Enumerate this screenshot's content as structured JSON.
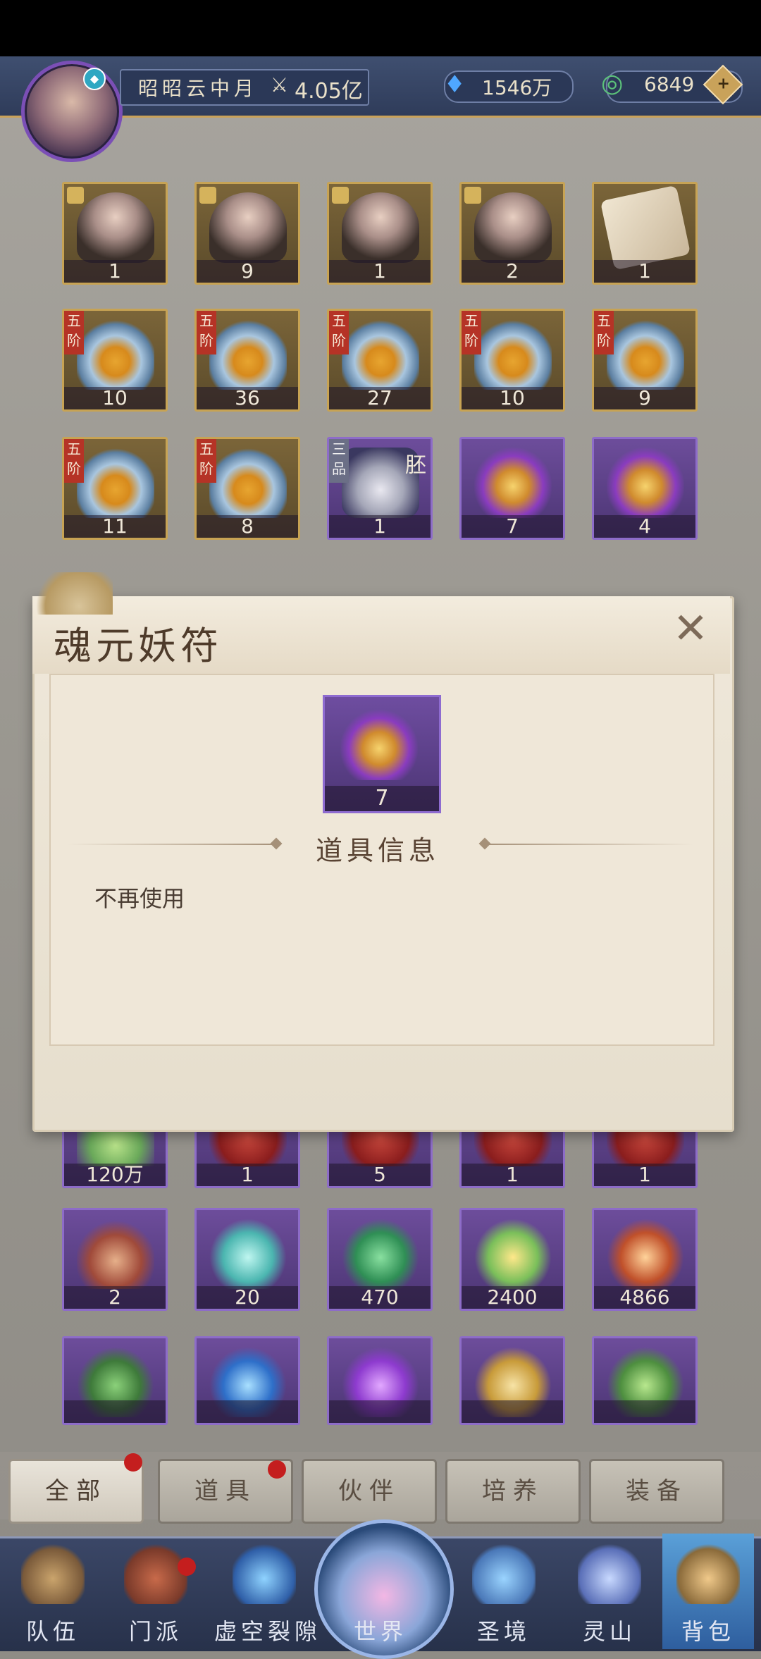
{
  "header": {
    "player_name": "昭昭云中月",
    "power": "4.05亿",
    "currency_1": "1546万",
    "currency_2": "6849",
    "add_symbol": "+"
  },
  "grid_rows": [
    {
      "items": [
        {
          "type": "portrait",
          "count": "1"
        },
        {
          "type": "portrait",
          "count": "9"
        },
        {
          "type": "portrait",
          "count": "1"
        },
        {
          "type": "portrait",
          "count": "2"
        },
        {
          "type": "scroll",
          "count": "1"
        }
      ]
    },
    {
      "items": [
        {
          "type": "lotus",
          "tag": "五阶",
          "count": "10"
        },
        {
          "type": "lotus",
          "tag": "五阶",
          "count": "36"
        },
        {
          "type": "lotus",
          "tag": "五阶",
          "count": "27"
        },
        {
          "type": "lotus",
          "tag": "五阶",
          "count": "10"
        },
        {
          "type": "lotus",
          "tag": "五阶",
          "count": "9"
        }
      ]
    },
    {
      "items": [
        {
          "type": "lotus",
          "tag": "五阶",
          "count": "11"
        },
        {
          "type": "lotus",
          "tag": "五阶",
          "count": "8"
        },
        {
          "type": "boots",
          "tag": "三品",
          "extra": "胚",
          "count": "1"
        },
        {
          "type": "talisman",
          "count": "7"
        },
        {
          "type": "talisman",
          "count": "4"
        }
      ]
    },
    {
      "items": [
        {
          "count": "120万"
        },
        {
          "count": "1"
        },
        {
          "count": "5"
        },
        {
          "count": "1"
        },
        {
          "count": "1"
        }
      ]
    },
    {
      "items": [
        {
          "count": "2"
        },
        {
          "count": "20"
        },
        {
          "count": "470"
        },
        {
          "count": "2400"
        },
        {
          "count": "4866"
        }
      ]
    },
    {
      "items": [
        {
          "count": ""
        },
        {
          "count": ""
        },
        {
          "count": ""
        },
        {
          "count": ""
        },
        {
          "count": ""
        }
      ]
    }
  ],
  "modal": {
    "title": "魂元妖符",
    "item_count": "7",
    "section_title": "道具信息",
    "description": "不再使用",
    "close_label": "✕"
  },
  "tabs": [
    "全部",
    "道具",
    "伙伴",
    "培养",
    "装备"
  ],
  "nav": [
    "队伍",
    "门派",
    "虚空裂隙",
    "世界",
    "圣境",
    "灵山",
    "背包"
  ],
  "icons": {
    "avatar": "avatar-icon",
    "power": "power-icon",
    "currency_1": "crystal-icon",
    "currency_2": "jade-coin-icon"
  }
}
